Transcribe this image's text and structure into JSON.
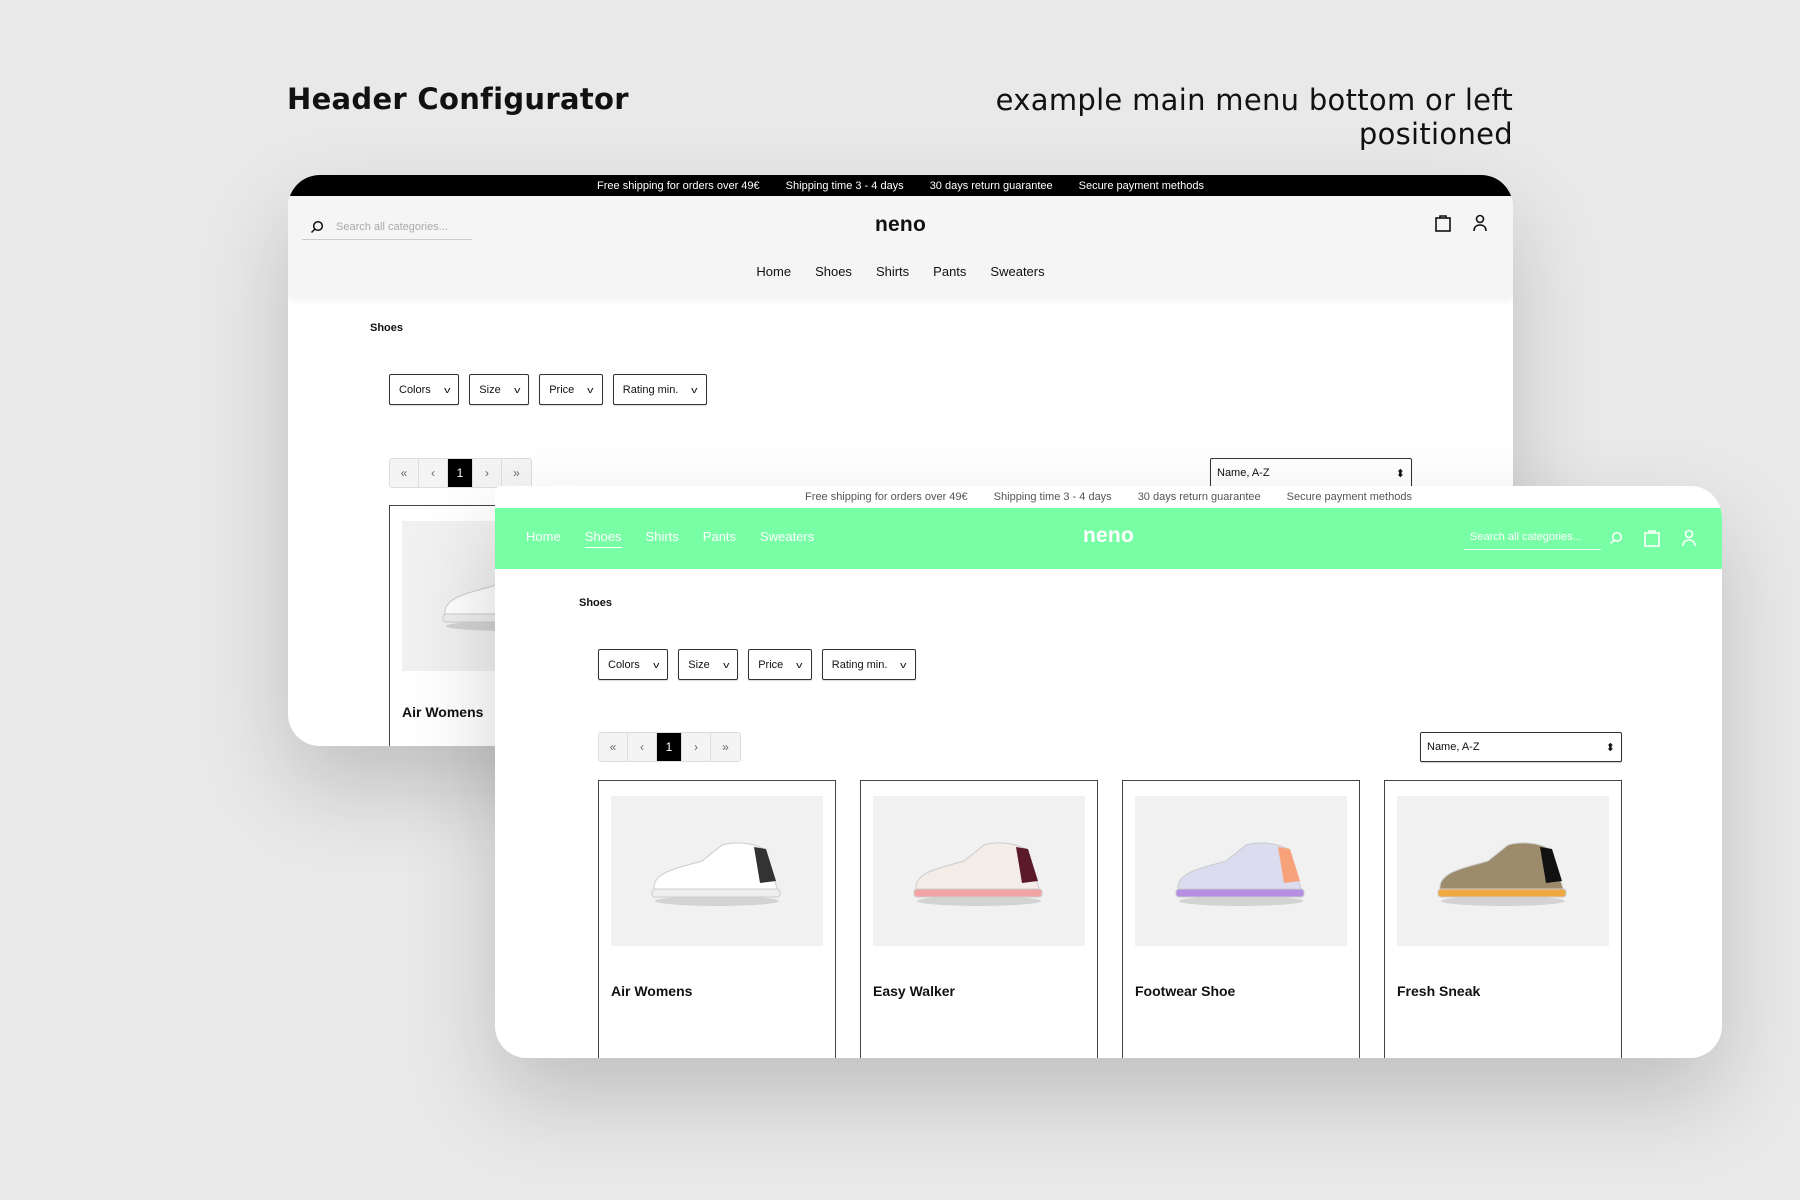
{
  "page": {
    "title": "Header Configurator",
    "subtitle": "example main menu bottom or left positioned"
  },
  "usp": [
    "Free shipping for orders over 49€",
    "Shipping time 3 - 4 days",
    "30 days return guarantee",
    "Secure payment methods"
  ],
  "logo": "neno",
  "search_placeholder": "Search all categories...",
  "nav": [
    "Home",
    "Shoes",
    "Shirts",
    "Pants",
    "Sweaters"
  ],
  "active_nav": "Shoes",
  "breadcrumb": "Shoes",
  "filters": [
    "Colors",
    "Size",
    "Price",
    "Rating min."
  ],
  "pagination": {
    "first": "«",
    "prev": "‹",
    "current": "1",
    "next": "›",
    "last": "»"
  },
  "sort": {
    "selected": "Name, A-Z"
  },
  "products": [
    {
      "name": "Air Womens",
      "colors": {
        "upper": "#ffffff",
        "accent": "#333333",
        "sole": "#eeeeee"
      }
    },
    {
      "name": "Easy Walker",
      "colors": {
        "upper": "#f4ece6",
        "accent": "#5a1a2a",
        "sole": "#f2a4a4"
      }
    },
    {
      "name": "Footwear Shoe",
      "colors": {
        "upper": "#dcdcf0",
        "accent": "#f7a27a",
        "sole": "#b48ee0"
      }
    },
    {
      "name": "Fresh Sneak",
      "colors": {
        "upper": "#9c8c6c",
        "accent": "#111111",
        "sole": "#f0a840"
      }
    }
  ],
  "colors": {
    "background": "#e8e9e8",
    "top_bar_back": "#000000",
    "header_back": "#f5f5f5",
    "header_front": "#78ffa5"
  }
}
